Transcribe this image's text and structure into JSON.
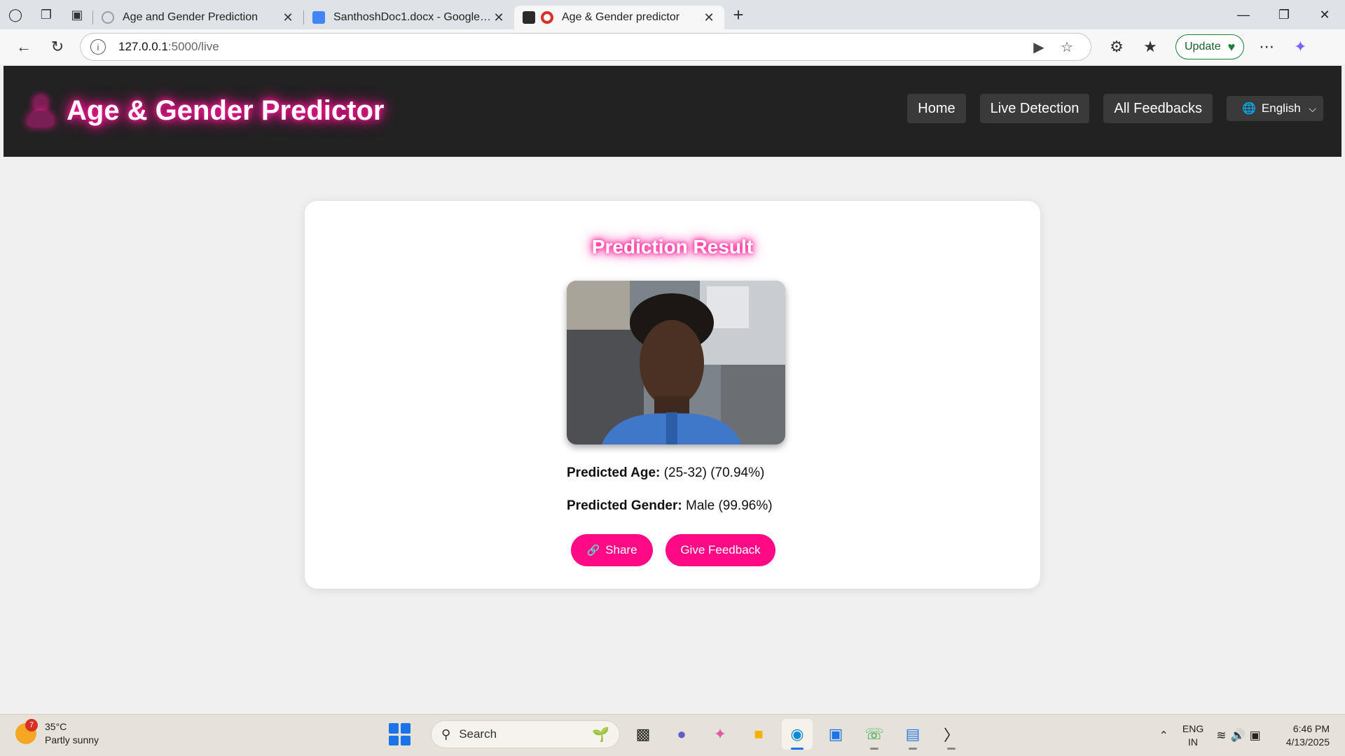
{
  "browser": {
    "tabs": [
      {
        "title": "Age and Gender Prediction",
        "favicon_color": "#9aa0a6",
        "active": false
      },
      {
        "title": "SanthoshDoc1.docx - Google Docs",
        "favicon_color": "#4285f4",
        "active": false
      },
      {
        "title": "Age & Gender predictor",
        "favicon_color": "#d93025",
        "active": true
      }
    ],
    "url_host": "127.0.0.1",
    "url_path": ":5000/live",
    "update_label": "Update"
  },
  "site": {
    "brand": "Age & Gender Predictor",
    "nav": {
      "home": "Home",
      "live": "Live Detection",
      "feedbacks": "All Feedbacks"
    },
    "language": "English",
    "accent_color": "#ff1493",
    "navbar_color": "#222222"
  },
  "result": {
    "title": "Prediction Result",
    "age_label": "Predicted Age:",
    "age_value": "(25-32) (70.94%)",
    "gender_label": "Predicted Gender:",
    "gender_value": "Male (99.96%)",
    "share_label": "Share",
    "feedback_label": "Give Feedback"
  },
  "taskbar": {
    "weather_badge": "7",
    "temperature": "35°C",
    "weather_desc": "Partly sunny",
    "search_placeholder": "Search",
    "lang_line1": "ENG",
    "lang_line2": "IN",
    "time": "6:46 PM",
    "date": "4/13/2025"
  }
}
